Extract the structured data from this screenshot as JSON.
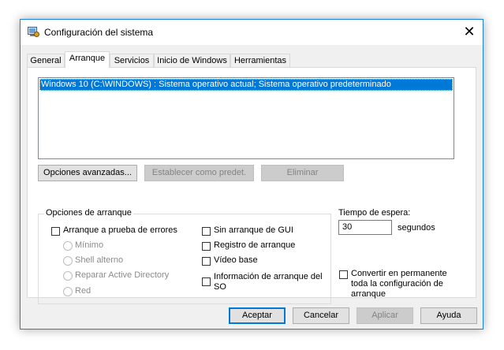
{
  "window": {
    "title": "Configuración del sistema",
    "close_glyph": "✕"
  },
  "tabs": [
    {
      "label": "General",
      "active": false
    },
    {
      "label": "Arranque",
      "active": true
    },
    {
      "label": "Servicios",
      "active": false
    },
    {
      "label": "Inicio de Windows",
      "active": false
    },
    {
      "label": "Herramientas",
      "active": false
    }
  ],
  "boot_list": {
    "items": [
      "Windows 10 (C:\\WINDOWS) : Sistema operativo actual; Sistema operativo predeterminado"
    ]
  },
  "boot_buttons": {
    "advanced": "Opciones avanzadas...",
    "set_default": "Establecer como predet.",
    "delete": "Eliminar"
  },
  "boot_options": {
    "group_label": "Opciones de arranque",
    "safe_boot": {
      "label": "Arranque a prueba de errores",
      "checked": false
    },
    "safe_modes": [
      "Mínimo",
      "Shell alterno",
      "Reparar Active Directory",
      "Red"
    ],
    "no_gui": {
      "label": "Sin arranque de GUI",
      "checked": false
    },
    "boot_log": {
      "label": "Registro de arranque",
      "checked": false
    },
    "base_video": {
      "label": "Vídeo base",
      "checked": false
    },
    "os_info": {
      "label_line1": "Información de arranque del",
      "label_line2": "SO",
      "checked": false
    }
  },
  "timeout": {
    "label": "Tiempo de espera:",
    "value": "30",
    "unit": "segundos"
  },
  "permanent": {
    "line1": "Convertir en permanente",
    "line2": "toda la configuración de",
    "line3": "arranque",
    "checked": false
  },
  "footer": {
    "ok": "Aceptar",
    "cancel": "Cancelar",
    "apply": "Aplicar",
    "help": "Ayuda"
  },
  "colors": {
    "accent": "#0078d7",
    "window_border": "#1883d7",
    "disabled_text": "#838383"
  },
  "icons": {
    "app": "msconfig-icon",
    "close": "close-icon"
  }
}
